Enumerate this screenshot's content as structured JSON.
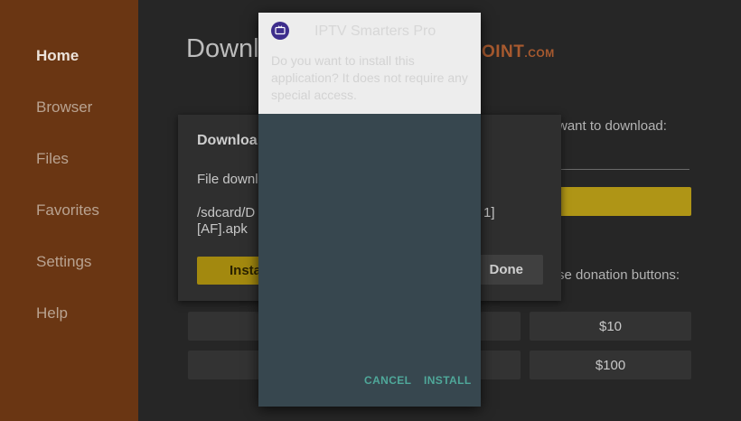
{
  "sidebar": {
    "items": [
      {
        "label": "Home",
        "active": true
      },
      {
        "label": "Browser"
      },
      {
        "label": "Files"
      },
      {
        "label": "Favorites"
      },
      {
        "label": "Settings"
      },
      {
        "label": "Help"
      }
    ]
  },
  "main": {
    "title_partial": "Downl",
    "brand": {
      "name": "OINT",
      "suffix": ".COM"
    },
    "url_prompt": "want to download:",
    "donation_prompt": "se donation buttons:",
    "donation_buttons": [
      "$10",
      "$100"
    ]
  },
  "download_card": {
    "title": "Downloa",
    "status": "File downl",
    "path_line1": "/sdcard/D",
    "path_line1_end": "1]",
    "path_line2": "[AF].apk",
    "install_label": "Insta",
    "done_label": "Done"
  },
  "dialog": {
    "app_name": "IPTV Smarters Pro",
    "message": "Do you want to install this application? It does not require any special access.",
    "cancel_label": "CANCEL",
    "install_label": "INSTALL"
  },
  "colors": {
    "sidebar": "#6a3613",
    "accent_yellow": "#af9516",
    "dialog_body": "#37474f",
    "dialog_button": "#4fa89a"
  }
}
